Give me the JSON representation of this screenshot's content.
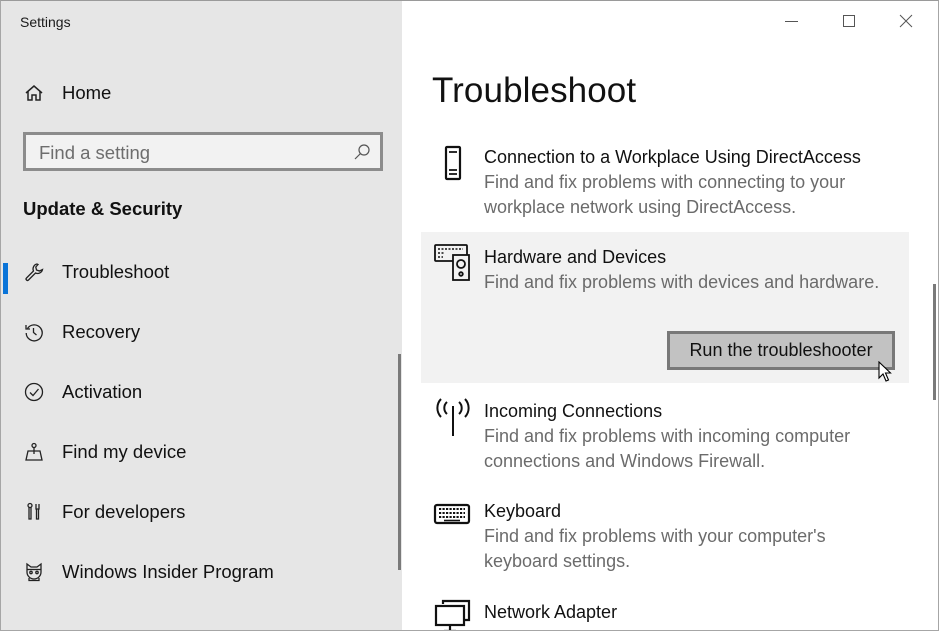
{
  "window": {
    "app_title": "Settings",
    "controls": {
      "minimize_icon": "minimize-icon",
      "maximize_icon": "maximize-icon",
      "close_icon": "close-icon"
    }
  },
  "sidebar": {
    "home_label": "Home",
    "home_icon": "home-icon",
    "search": {
      "placeholder": "Find a setting",
      "value": "",
      "icon": "search-icon"
    },
    "section_heading": "Update & Security",
    "items": [
      {
        "label": "Troubleshoot",
        "icon": "wrench-icon",
        "active": true
      },
      {
        "label": "Recovery",
        "icon": "history-icon",
        "active": false
      },
      {
        "label": "Activation",
        "icon": "check-circle-icon",
        "active": false
      },
      {
        "label": "Find my device",
        "icon": "find-device-icon",
        "active": false
      },
      {
        "label": "For developers",
        "icon": "developer-tools-icon",
        "active": false
      },
      {
        "label": "Windows Insider Program",
        "icon": "insider-ninjacat-icon",
        "active": false
      }
    ],
    "accent_color": "#0a74d8"
  },
  "main": {
    "title": "Troubleshoot",
    "items": [
      {
        "title": "Connection to a Workplace Using DirectAccess",
        "description": "Find and fix problems with connecting to your workplace network using DirectAccess.",
        "icon": "phone-device-icon"
      },
      {
        "title": "Hardware and Devices",
        "description": "Find and fix problems with devices and hardware.",
        "icon": "hardware-devices-icon",
        "selected": true,
        "button_label": "Run the troubleshooter"
      },
      {
        "title": "Incoming Connections",
        "description": "Find and fix problems with incoming computer connections and Windows Firewall.",
        "icon": "antenna-icon"
      },
      {
        "title": "Keyboard",
        "description": "Find and fix problems with your computer's keyboard settings.",
        "icon": "keyboard-icon"
      },
      {
        "title": "Network Adapter",
        "description": "",
        "icon": "network-adapter-icon"
      }
    ]
  }
}
